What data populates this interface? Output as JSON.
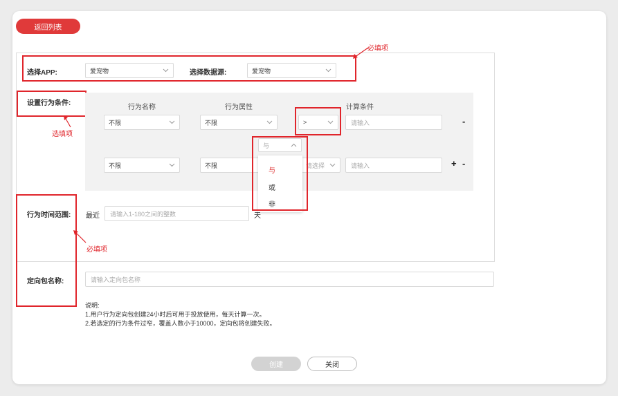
{
  "header": {
    "back_label": "返回列表"
  },
  "app_row": {
    "app_label": "选择APP:",
    "app_value": "爱宠物",
    "source_label": "选择数据源:",
    "source_value": "爱宠物"
  },
  "behavior": {
    "label": "设置行为条件:",
    "col_name": "行为名称",
    "col_attr": "行为属性",
    "col_calc": "计算条件",
    "row1": {
      "name": "不限",
      "attr": "不限",
      "op": ">",
      "value_placeholder": "请输入",
      "action": "-"
    },
    "logic_select": "与",
    "logic_options": [
      "与",
      "或",
      "非"
    ],
    "row2": {
      "name": "不限",
      "attr": "不限",
      "op_placeholder": "请选择",
      "value_placeholder": "请输入",
      "add": "+",
      "remove": "-"
    }
  },
  "time_range": {
    "label": "行为时间范围:",
    "prefix": "最近",
    "placeholder": "请输入1-180之间的整数",
    "suffix": "天"
  },
  "package": {
    "label": "定向包名称:",
    "placeholder": "请输入定向包名称"
  },
  "notes": {
    "title": "说明:",
    "line1": "1.用户行为定向包创建24小时后可用于投放使用，每天计算一次。",
    "line2": "2.若选定的行为条件过窄，覆盖人数小于10000，定向包将创建失败。"
  },
  "footer": {
    "create_label": "创建",
    "close_label": "关闭"
  },
  "annotations": {
    "required_top": "必填项",
    "optional": "选填项",
    "required_left": "必填项"
  },
  "colors": {
    "accent": "#e03a3a",
    "annotation": "#e0252b"
  },
  "icons": [
    "chevron-down-icon",
    "chevron-up-icon",
    "arrow-icon"
  ]
}
